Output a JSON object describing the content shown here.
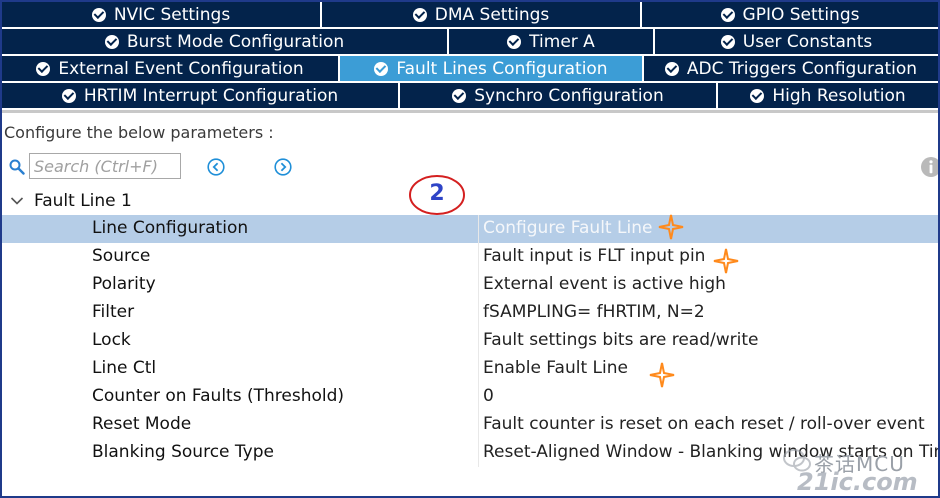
{
  "tabs": {
    "row1": [
      {
        "label": "NVIC Settings"
      },
      {
        "label": "DMA Settings"
      },
      {
        "label": "GPIO Settings"
      }
    ],
    "row2": [
      {
        "label": "Burst Mode Configuration"
      },
      {
        "label": "Timer A"
      },
      {
        "label": "User Constants"
      }
    ],
    "row3": [
      {
        "label": "External Event Configuration"
      },
      {
        "label": "Fault Lines Configuration",
        "active": true
      },
      {
        "label": "ADC Triggers Configuration"
      }
    ],
    "row4": [
      {
        "label": "HRTIM Interrupt Configuration"
      },
      {
        "label": "Synchro Configuration"
      },
      {
        "label": "High Resolution"
      }
    ]
  },
  "config_label": "Configure the below parameters :",
  "search": {
    "placeholder": "Search (Ctrl+F)",
    "value": ""
  },
  "tree": {
    "group_label": "Fault Line 1"
  },
  "annotation": {
    "number": "2"
  },
  "parameters": [
    {
      "name": "Line Configuration",
      "value": "Configure Fault Line",
      "selected": true
    },
    {
      "name": "Source",
      "value": "Fault input is FLT input pin"
    },
    {
      "name": "Polarity",
      "value": "External event is active high"
    },
    {
      "name": "Filter",
      "value": "fSAMPLING= fHRTIM, N=2"
    },
    {
      "name": "Lock",
      "value": "Fault settings bits are read/write"
    },
    {
      "name": "Line Ctl",
      "value": "Enable Fault Line"
    },
    {
      "name": "Counter on Faults (Threshold)",
      "value": "0"
    },
    {
      "name": "Reset Mode",
      "value": "Fault counter is reset on each reset / roll-over event"
    },
    {
      "name": "Blanking Source Type",
      "value": "Reset-Aligned Window - Blanking window starts on Time"
    }
  ],
  "watermark": {
    "text": "茶话MCU",
    "logo": "21ic.com"
  },
  "colors": {
    "tab_bg": "#03234b",
    "tab_active": "#3c9dd6",
    "selected_row": "#b5cde7",
    "annotation_red": "#d42020",
    "star_orange": "#ff8a1c"
  },
  "icons": {
    "check": "check-circle-icon",
    "search": "search-icon",
    "prev": "chevron-left-circle-icon",
    "next": "chevron-right-circle-icon",
    "info": "info-icon",
    "star": "sparkle-star-icon"
  }
}
